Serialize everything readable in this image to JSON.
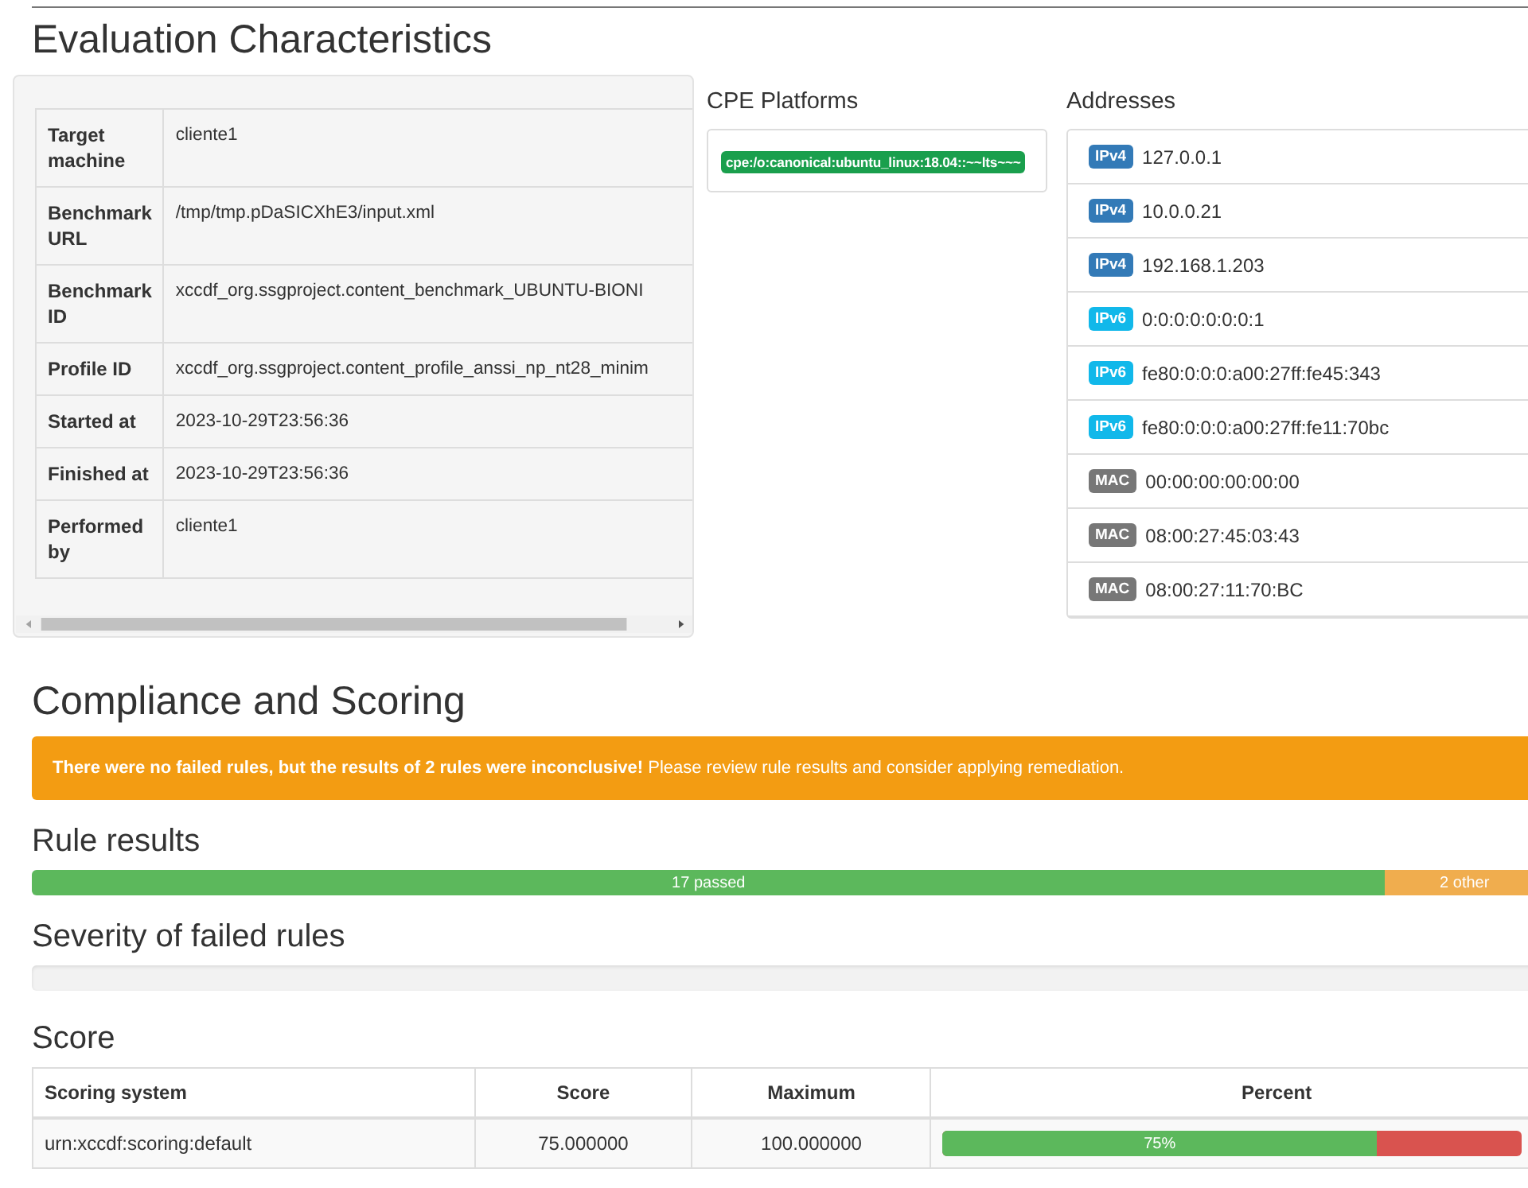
{
  "title": "Evaluation Characteristics",
  "characteristics": [
    {
      "label": "Target machine",
      "value": "cliente1"
    },
    {
      "label": "Benchmark URL",
      "value": "/tmp/tmp.pDaSICXhE3/input.xml"
    },
    {
      "label": "Benchmark ID",
      "value": "xccdf_org.ssgproject.content_benchmark_UBUNTU-BIONI"
    },
    {
      "label": "Profile ID",
      "value": "xccdf_org.ssgproject.content_profile_anssi_np_nt28_minim"
    },
    {
      "label": "Started at",
      "value": "2023-10-29T23:56:36"
    },
    {
      "label": "Finished at",
      "value": "2023-10-29T23:56:36"
    },
    {
      "label": "Performed by",
      "value": "cliente1"
    }
  ],
  "cpe": {
    "heading": "CPE Platforms",
    "platforms": [
      "cpe:/o:canonical:ubuntu_linux:18.04::~~lts~~~"
    ]
  },
  "addresses": {
    "heading": "Addresses",
    "items": [
      {
        "kind": "ipv4",
        "tag": "IPv4",
        "value": "127.0.0.1"
      },
      {
        "kind": "ipv4",
        "tag": "IPv4",
        "value": "10.0.0.21"
      },
      {
        "kind": "ipv4",
        "tag": "IPv4",
        "value": "192.168.1.203"
      },
      {
        "kind": "ipv6",
        "tag": "IPv6",
        "value": "0:0:0:0:0:0:0:1"
      },
      {
        "kind": "ipv6",
        "tag": "IPv6",
        "value": "fe80:0:0:0:a00:27ff:fe45:343"
      },
      {
        "kind": "ipv6",
        "tag": "IPv6",
        "value": "fe80:0:0:0:a00:27ff:fe11:70bc"
      },
      {
        "kind": "mac",
        "tag": "MAC",
        "value": "00:00:00:00:00:00"
      },
      {
        "kind": "mac",
        "tag": "MAC",
        "value": "08:00:27:45:03:43"
      },
      {
        "kind": "mac",
        "tag": "MAC",
        "value": "08:00:27:11:70:BC"
      }
    ]
  },
  "compliance": {
    "heading": "Compliance and Scoring",
    "alert": "**There were no failed rules, but the results of 2 rules were inconclusive!** Please review rule results and consider applying remediation."
  },
  "rule_results": {
    "heading": "Rule results",
    "segments": [
      {
        "kind": "passed",
        "label": "17 passed",
        "level": 0.895
      },
      {
        "kind": "other",
        "label": "2 other",
        "level": 0.105
      }
    ]
  },
  "severity": {
    "heading": "Severity of failed rules"
  },
  "score": {
    "heading": "Score",
    "columns": [
      "Scoring system",
      "Score",
      "Maximum",
      "Percent"
    ],
    "rows": [
      {
        "system": "urn:xccdf:scoring:default",
        "score": "75.000000",
        "maximum": "100.000000",
        "percent": "75%",
        "level": 0.75
      }
    ]
  }
}
